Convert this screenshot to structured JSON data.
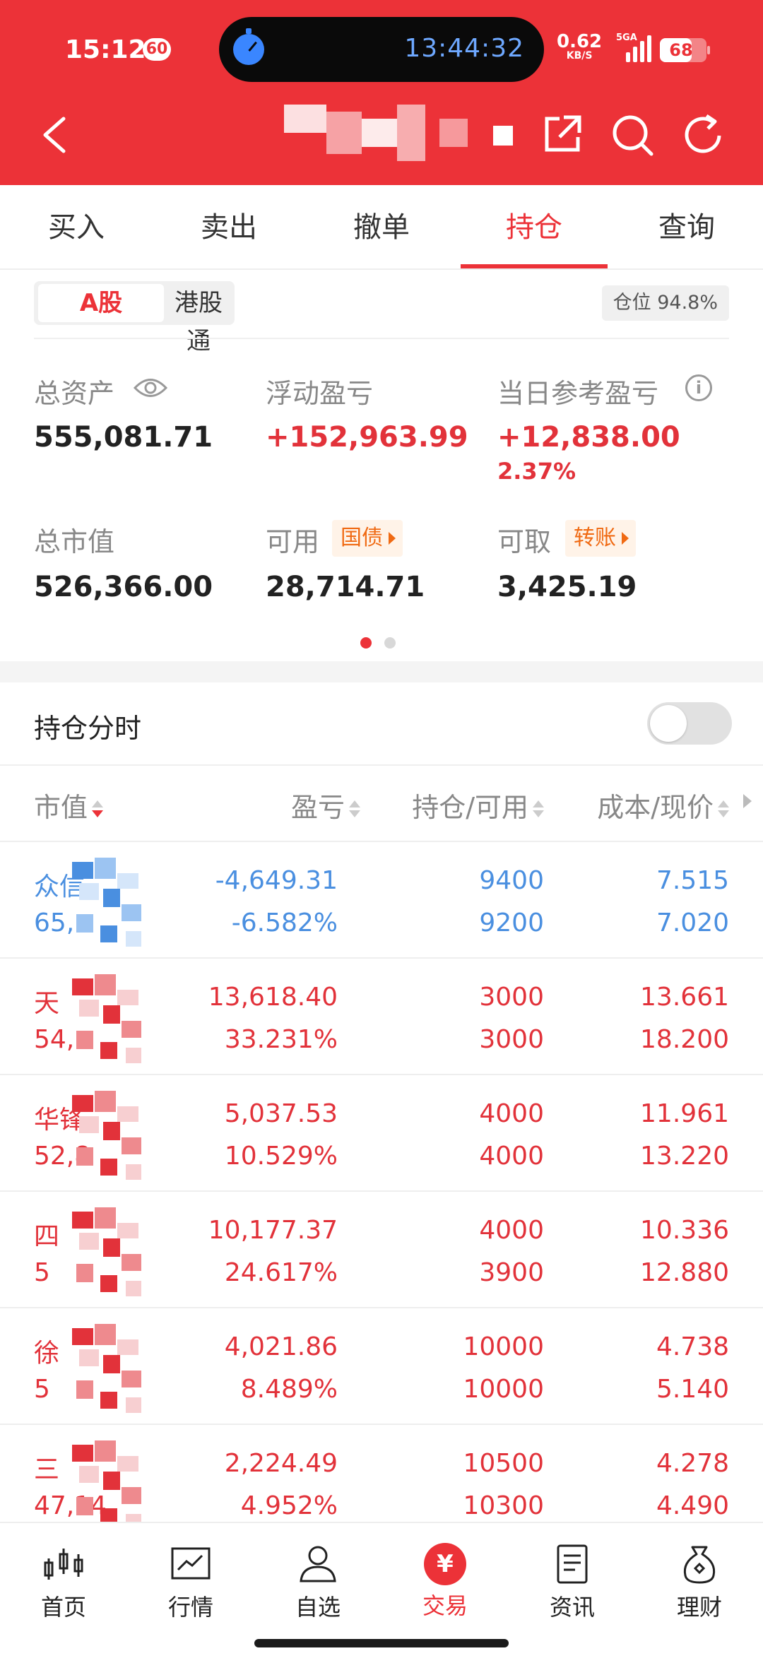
{
  "status_bar": {
    "time": "15:12",
    "notification_count": "60",
    "stopwatch_time": "13:44:32",
    "net_speed": "0.62",
    "net_unit": "KB/S",
    "signal_label": "5GA",
    "battery": "68",
    "battery_level": 0.68
  },
  "tabs": [
    "买入",
    "卖出",
    "撤单",
    "持仓",
    "查询"
  ],
  "active_tab": "持仓",
  "market_segment": {
    "a_share": "A股",
    "hk_connect": "港股通"
  },
  "position_ratio": "仓位 94.8%",
  "summary": {
    "total_assets_label": "总资产",
    "total_assets": "555,081.71",
    "floating_pl_label": "浮动盈亏",
    "floating_pl": "+152,963.99",
    "daily_pl_label": "当日参考盈亏",
    "daily_pl": "+12,838.00",
    "daily_pl_pct": "2.37%",
    "market_value_label": "总市值",
    "market_value": "526,366.00",
    "available_label": "可用",
    "available": "28,714.71",
    "bond_tag": "国债",
    "withdrawable_label": "可取",
    "withdrawable": "3,425.19",
    "transfer_tag": "转账"
  },
  "holdings_timeshare": "持仓分时",
  "columns": {
    "market_value": "市值",
    "pl": "盈亏",
    "position": "持仓/可用",
    "cost": "成本/现价"
  },
  "holdings": [
    {
      "name": "众信",
      "market_value": "65,",
      "pl": "-4,649.31",
      "pl_pct": "-6.582%",
      "qty": "9400",
      "avail": "9200",
      "cost": "7.515",
      "price": "7.020",
      "tone": "blue"
    },
    {
      "name": "天",
      "market_value": "54,",
      "pl": "13,618.40",
      "pl_pct": "33.231%",
      "qty": "3000",
      "avail": "3000",
      "cost": "13.661",
      "price": "18.200",
      "tone": "red"
    },
    {
      "name": "华锋",
      "market_value": "52,8",
      "pl": "5,037.53",
      "pl_pct": "10.529%",
      "qty": "4000",
      "avail": "4000",
      "cost": "11.961",
      "price": "13.220",
      "tone": "red"
    },
    {
      "name": "四",
      "market_value": "5",
      "pl": "10,177.37",
      "pl_pct": "24.617%",
      "qty": "4000",
      "avail": "3900",
      "cost": "10.336",
      "price": "12.880",
      "tone": "red"
    },
    {
      "name": "徐",
      "market_value": "5",
      "pl": "4,021.86",
      "pl_pct": "8.489%",
      "qty": "10000",
      "avail": "10000",
      "cost": "4.738",
      "price": "5.140",
      "tone": "red"
    },
    {
      "name": "三",
      "market_value": "47,14",
      "pl": "2,224.49",
      "pl_pct": "4.952%",
      "qty": "10500",
      "avail": "10300",
      "cost": "4.278",
      "price": "4.490",
      "tone": "red"
    }
  ],
  "bottom_nav": [
    "首页",
    "行情",
    "自选",
    "交易",
    "资讯",
    "理财"
  ],
  "active_nav": "交易",
  "trade_icon_glyph": "¥",
  "colors": {
    "brand_red": "#ec3238",
    "gain_red": "#e2323a",
    "loss_blue": "#4a8fe0",
    "tag_orange": "#f06a13"
  }
}
